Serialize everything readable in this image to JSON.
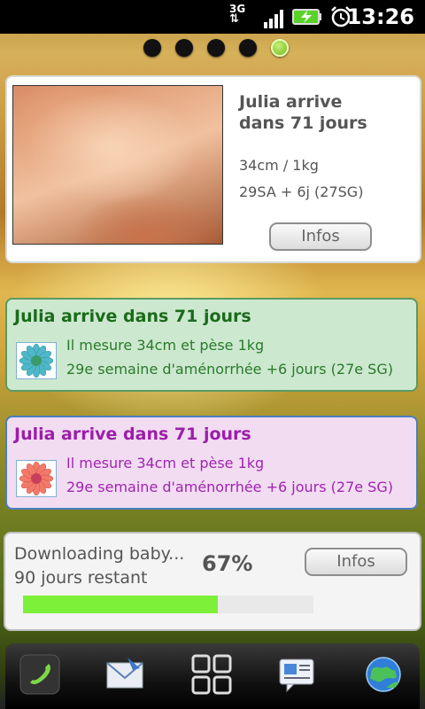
{
  "status_bar": {
    "network": "3G",
    "time": "13:26",
    "icons": [
      "network-3g-icon",
      "signal-icon",
      "battery-charging-icon",
      "alarm-icon"
    ]
  },
  "home_pages": {
    "count": 5,
    "active_index": 4
  },
  "widget_large": {
    "title_line1": "Julia arrive",
    "title_line2": "dans 71 jours",
    "size_weight": "34cm / 1kg",
    "gestation": "29SA + 6j (27SG)",
    "button_label": "Infos"
  },
  "widget_green": {
    "title": "Julia arrive dans 71 jours",
    "line1": "Il mesure 34cm et pèse 1kg",
    "line2": "29e semaine d'aménorrhée +6 jours (27e SG)",
    "title_color": "#1a6b1a",
    "text_color": "#2a7a2a",
    "icon": "blue-flower-icon"
  },
  "widget_pink": {
    "title": "Julia arrive dans 71 jours",
    "line1": "Il mesure 34cm et pèse 1kg",
    "line2": "29e semaine d'aménorrhée +6 jours (27e SG)",
    "title_color": "#9b1ea8",
    "text_color": "#a024b0",
    "icon": "pink-flower-icon"
  },
  "widget_download": {
    "line1": "Downloading baby...",
    "line2": "90 jours restant",
    "percent_label": "67%",
    "progress": 0.67,
    "button_label": "Infos",
    "progress_color": "#7df03a"
  },
  "dock": {
    "items": [
      "phone-icon",
      "mail-icon",
      "apps-grid-icon",
      "messages-icon",
      "browser-globe-icon"
    ]
  }
}
